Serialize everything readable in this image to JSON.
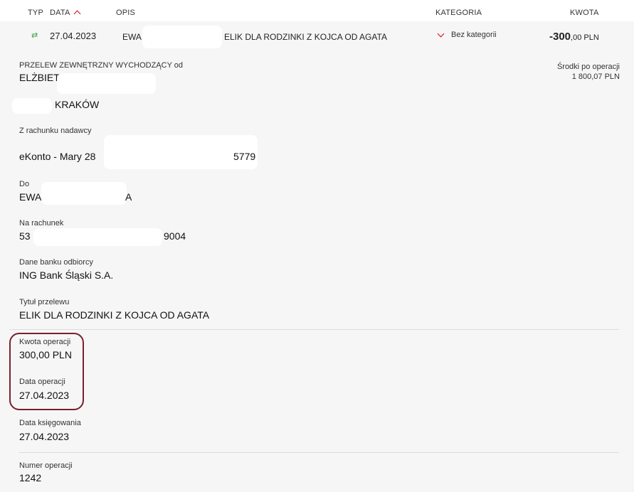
{
  "header": {
    "col_type": "TYP",
    "col_date": "DATA",
    "col_desc": "OPIS",
    "col_category": "KATEGORIA",
    "col_amount": "KWOTA"
  },
  "transaction": {
    "date": "27.04.2023",
    "desc_start": "EWA",
    "desc_end": "ELIK DLA RODZINKI Z KOJCA OD AGATA",
    "category": "Bez kategorii",
    "amount_main": "-300",
    "amount_cents": ",00 PLN"
  },
  "details": {
    "type_label": "PRZELEW ZEWNĘTRZNY WYCHODZĄCY od",
    "sender_name": "ELŻBIETA",
    "sender_city": "KRAKÓW",
    "balance_label": "Środki po operacji",
    "balance_value": "1 800,07 PLN",
    "from_account_label": "Z rachunku nadawcy",
    "from_account_name": "eKonto - Mary 28",
    "from_account_end": "5779",
    "to_label": "Do",
    "to_name_start": "EWA",
    "to_name_end": "A",
    "to_account_label": "Na rachunek",
    "to_account_start": "53",
    "to_account_end": "9004",
    "bank_label": "Dane banku odbiorcy",
    "bank_value": "ING Bank Śląski S.A.",
    "title_label": "Tytuł przelewu",
    "title_value": "ELIK DLA RODZINKI Z KOJCA OD AGATA",
    "amount_label": "Kwota operacji",
    "amount_value": "300,00 PLN",
    "op_date_label": "Data operacji",
    "op_date_value": "27.04.2023",
    "booking_date_label": "Data księgowania",
    "booking_date_value": "27.04.2023",
    "op_number_label": "Numer operacji",
    "op_number_value": "1242"
  },
  "icons": {
    "transfer": "arrows-exchange-icon",
    "sort": "chevron-up-icon",
    "category": "chevron-down-icon"
  },
  "colors": {
    "accent": "#d0021b",
    "transfer_icon": "#3aa34a",
    "highlight_border": "#7a1f2e"
  }
}
